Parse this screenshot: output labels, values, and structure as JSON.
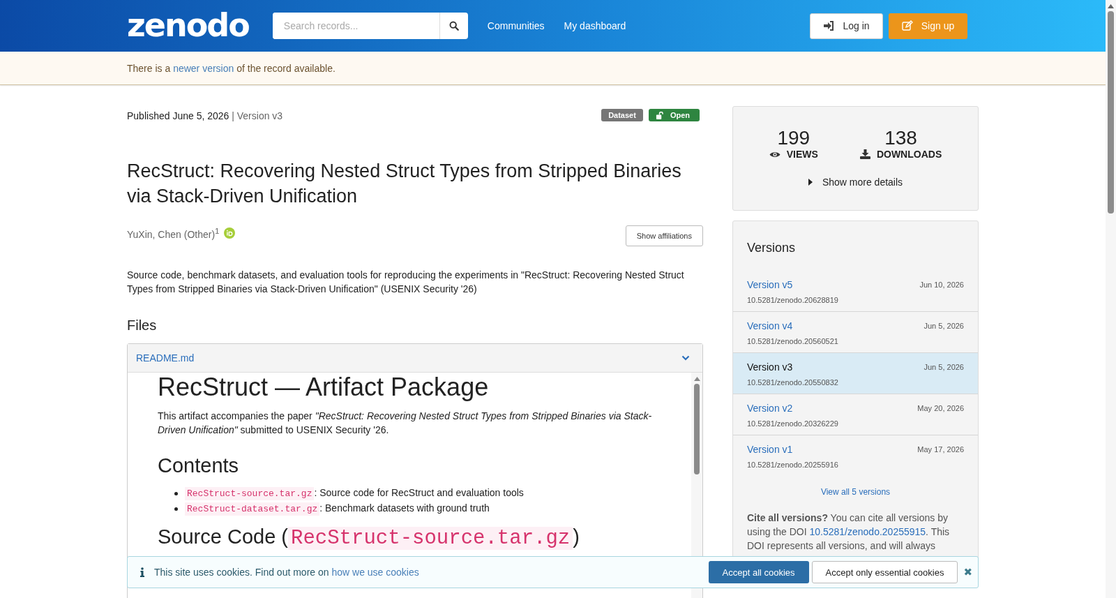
{
  "header": {
    "logo": "zenodo",
    "search": {
      "placeholder": "Search records..."
    },
    "nav": [
      "Communities",
      "My dashboard"
    ],
    "login": "Log in",
    "signup": "Sign up"
  },
  "notice": {
    "before": "There is a ",
    "link": "newer version",
    "after": " of the record available."
  },
  "record": {
    "published": "Published June 5, 2026",
    "version": "| Version v3",
    "badges": [
      {
        "kind": "type",
        "label": "Dataset"
      },
      {
        "kind": "access",
        "label": "Open"
      }
    ],
    "title": "RecStruct: Recovering Nested Struct Types from Stripped Binaries via Stack-Driven Unification",
    "author": "YuXin, Chen (Other)$^{1}$",
    "affiliations_button": "Show affiliations",
    "description": "Source code, benchmark datasets, and evaluation tools for reproducing the experiments in \"RecStruct: Recovering Nested Struct Types from Stripped Binaries via Stack-Driven Unification\" (USENIX Security '26)"
  },
  "files": {
    "heading": "Files",
    "file": "README.md",
    "readme": {
      "title": "RecStruct — Artifact Package",
      "intro": "This artifact accompanies the paper *\"RecStruct: Recovering Nested Struct Types from Stripped Binaries via Stack-Driven Unification\"* submitted to USENIX Security '26.",
      "contents_heading": "Contents",
      "items": [
        {
          "code": "RecStruct-source.tar.gz",
          "text": ": Source code for RecStruct and evaluation tools"
        },
        {
          "code": "RecStruct-dataset.tar.gz",
          "text": ": Benchmark datasets with ground truth"
        }
      ],
      "section_heading": "Source Code (",
      "section_code": "RecStruct-source.tar.gz",
      "section_close": ")"
    }
  },
  "stats": {
    "views": "199",
    "views_label": "VIEWS",
    "downloads": "138",
    "downloads_label": "DOWNLOADS",
    "more": "Show more details"
  },
  "versions": {
    "heading": "Versions",
    "items": [
      {
        "label": "Version v5",
        "date": "Jun 10, 2026",
        "doi": "10.5281/zenodo.20628819",
        "selected": false
      },
      {
        "label": "Version v4",
        "date": "Jun 5, 2026",
        "doi": "10.5281/zenodo.20560521",
        "selected": false
      },
      {
        "label": "Version v3",
        "date": "Jun 5, 2026",
        "doi": "10.5281/zenodo.20550832",
        "selected": true
      },
      {
        "label": "Version v2",
        "date": "May 20, 2026",
        "doi": "10.5281/zenodo.20326229",
        "selected": false
      },
      {
        "label": "Version v1",
        "date": "May 17, 2026",
        "doi": "10.5281/zenodo.20255916",
        "selected": false
      }
    ],
    "view_all": "View all 5 versions",
    "cite_bold": "Cite all versions?",
    "cite_text": " You can cite all versions by using the DOI ",
    "cite_link": "10.5281/zenodo.20255915",
    "cite_after": ". This DOI represents all versions, and will always"
  },
  "cookies": {
    "text": "This site uses cookies. Find out more on ",
    "link": "how we use cookies",
    "accept_all": "Accept all cookies",
    "accept_essential": "Accept only essential cookies",
    "close": "✖"
  }
}
